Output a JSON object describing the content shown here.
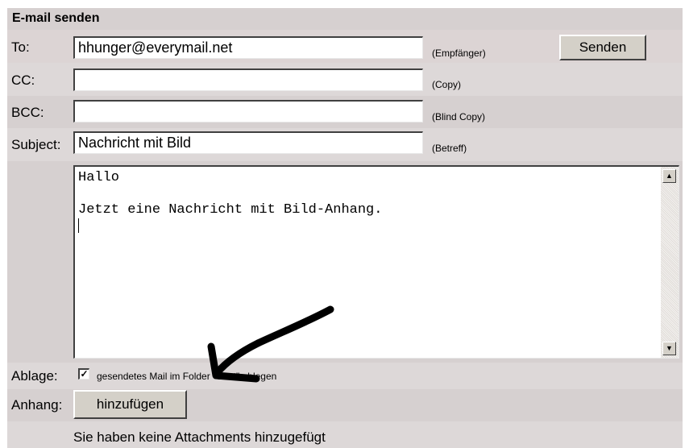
{
  "form": {
    "title": "E-mail senden",
    "to": {
      "label": "To:",
      "value": "hhunger@everymail.net",
      "hint": "(Empfänger)"
    },
    "send_button": "Senden",
    "cc": {
      "label": "CC:",
      "value": "",
      "hint": "(Copy)"
    },
    "bcc": {
      "label": "BCC:",
      "value": "",
      "hint": "(Blind Copy)"
    },
    "subject": {
      "label": "Subject:",
      "value": "Nachricht mit Bild",
      "hint": "(Betreff)"
    },
    "body": "Hallo\n\nJetzt eine Nachricht mit Bild-Anhang.",
    "ablage": {
      "label": "Ablage:",
      "checked": true,
      "checkbox_label": "gesendetes Mail im Folder \"Sent\" ablegen"
    },
    "anhang": {
      "label": "Anhang:",
      "button": "hinzufügen"
    },
    "attachments_info": "Sie haben keine Attachments hinzugefügt"
  },
  "icons": {
    "scroll_up": "scroll-up-arrow",
    "scroll_down": "scroll-down-arrow",
    "checkmark": "check-mark",
    "annotation_arrow": "hand-drawn-arrow"
  }
}
